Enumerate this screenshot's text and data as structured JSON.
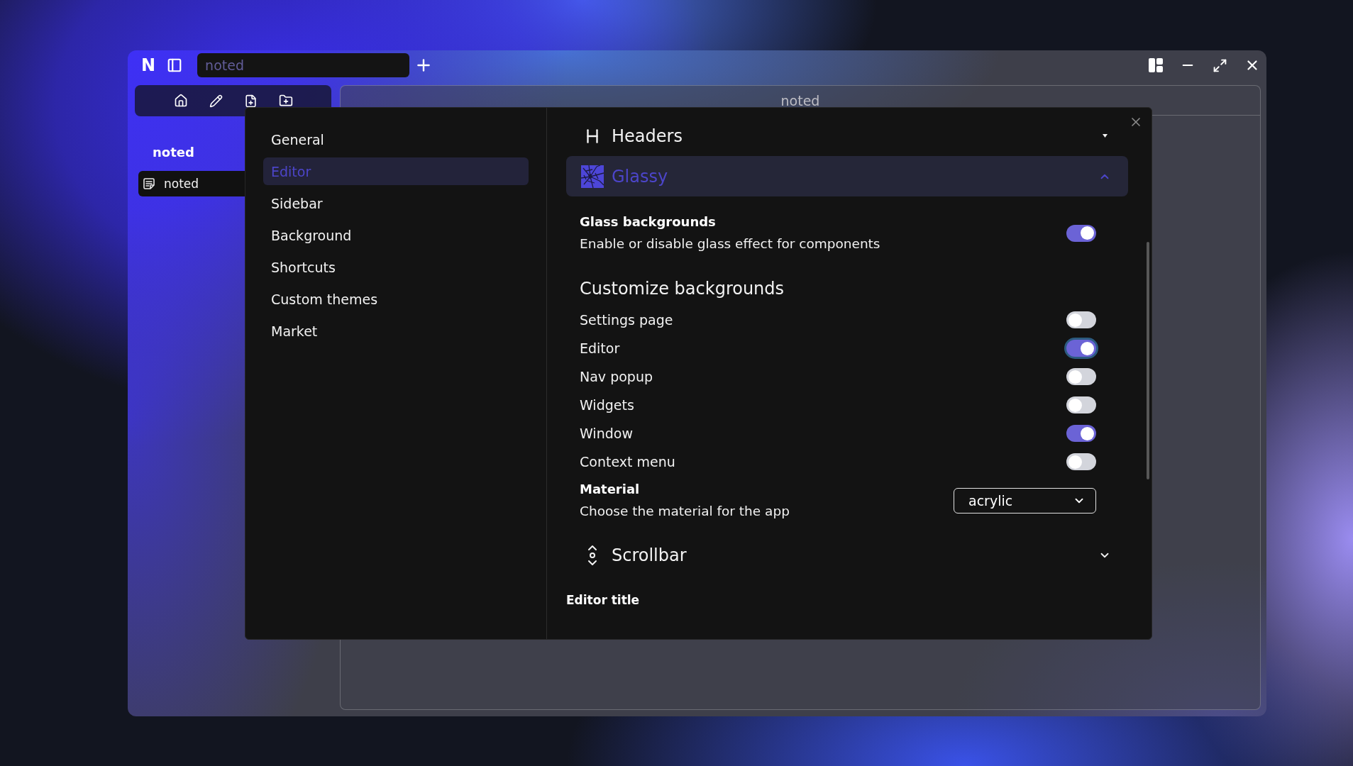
{
  "titlebar": {
    "logo": "N",
    "title_field": {
      "placeholder": "noted"
    }
  },
  "sidebar": {
    "heading": "noted",
    "items": [
      {
        "label": "noted",
        "selected": true
      }
    ]
  },
  "editor_panel": {
    "title": "noted"
  },
  "settings_dialog": {
    "nav": [
      {
        "label": "General",
        "selected": false
      },
      {
        "label": "Editor",
        "selected": true
      },
      {
        "label": "Sidebar",
        "selected": false
      },
      {
        "label": "Background",
        "selected": false
      },
      {
        "label": "Shortcuts",
        "selected": false
      },
      {
        "label": "Custom themes",
        "selected": false
      },
      {
        "label": "Market",
        "selected": false
      }
    ],
    "sections": [
      {
        "title": "Headers",
        "expanded": false
      },
      {
        "title": "Glassy",
        "expanded": true,
        "content": {
          "glass_backgrounds": {
            "label": "Glass backgrounds",
            "description": "Enable or disable glass effect for components",
            "on": true
          },
          "customize_backgrounds": {
            "heading": "Customize backgrounds",
            "toggles": [
              {
                "label": "Settings page",
                "on": false,
                "focused": false
              },
              {
                "label": "Editor",
                "on": true,
                "focused": true
              },
              {
                "label": "Nav popup",
                "on": false,
                "focused": false
              },
              {
                "label": "Widgets",
                "on": false,
                "focused": false
              },
              {
                "label": "Window",
                "on": true,
                "focused": false
              },
              {
                "label": "Context menu",
                "on": false,
                "focused": false
              }
            ]
          },
          "material": {
            "label": "Material",
            "description": "Choose the material for the app",
            "value": "acrylic"
          }
        }
      },
      {
        "title": "Scrollbar",
        "expanded": false
      }
    ],
    "next_section_title": "Editor title"
  }
}
